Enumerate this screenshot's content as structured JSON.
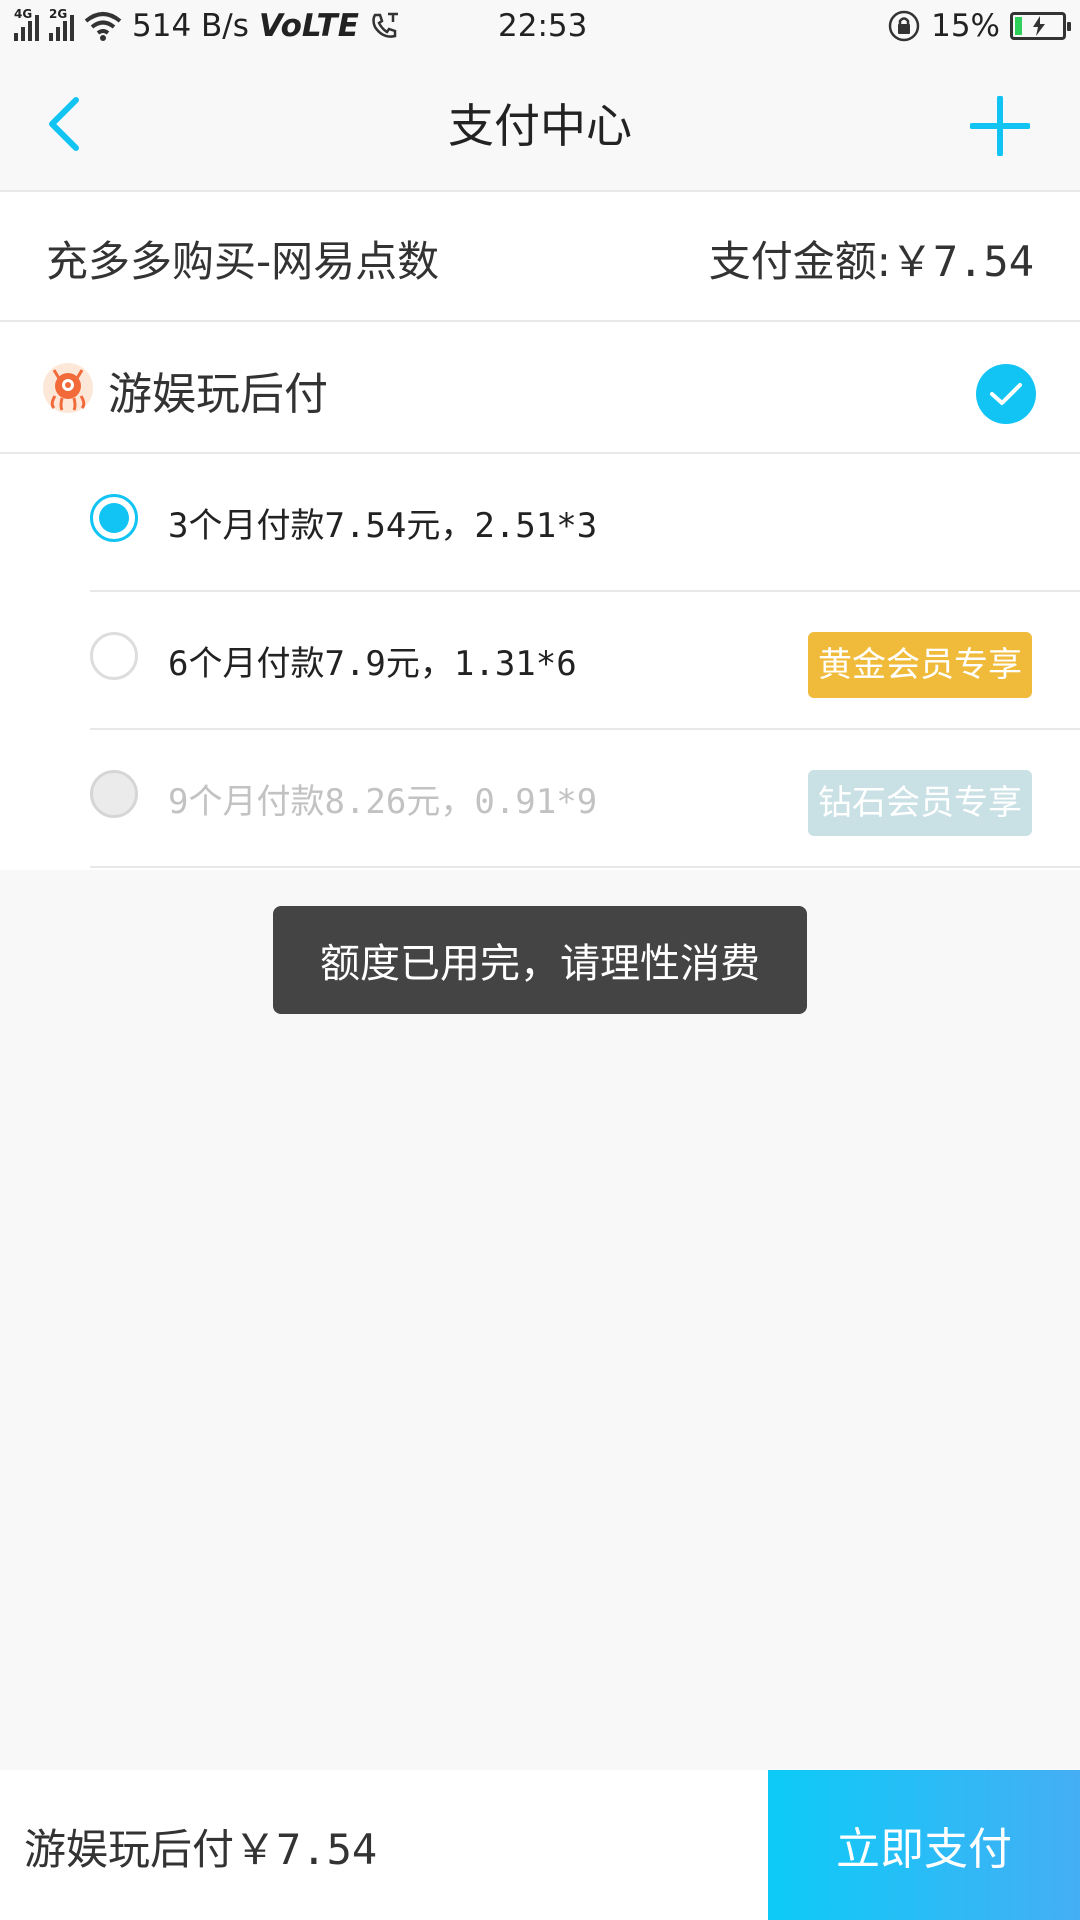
{
  "status_bar": {
    "net_4g": "4G",
    "net_2g": "2G",
    "speed": "514 B/s",
    "volte": "VoLTE",
    "time": "22:53",
    "battery": "15%",
    "battery_level": 0.15
  },
  "nav": {
    "title": "支付中心"
  },
  "order": {
    "product": "充多多购买-网易点数",
    "amount_label": "支付金额:",
    "amount": "￥7.54"
  },
  "method": {
    "name": "游娱玩后付"
  },
  "plans": [
    {
      "label": "3个月付款7.54元，2.51*3",
      "selected": true
    },
    {
      "label": "6个月付款7.9元，1.31*6",
      "badge": "黄金会员专享"
    },
    {
      "label": "9个月付款8.26元，0.91*9",
      "badge": "钻石会员专享"
    }
  ],
  "toast": "额度已用完，请理性消费",
  "bottom": {
    "method": "游娱玩后付",
    "amount": "￥7.54",
    "pay_button": "立即支付"
  },
  "colors": {
    "accent": "#11c4f4",
    "gold_badge": "#f0bb3a",
    "diamond_badge": "#c9e0e4",
    "toast_bg": "#444444"
  }
}
